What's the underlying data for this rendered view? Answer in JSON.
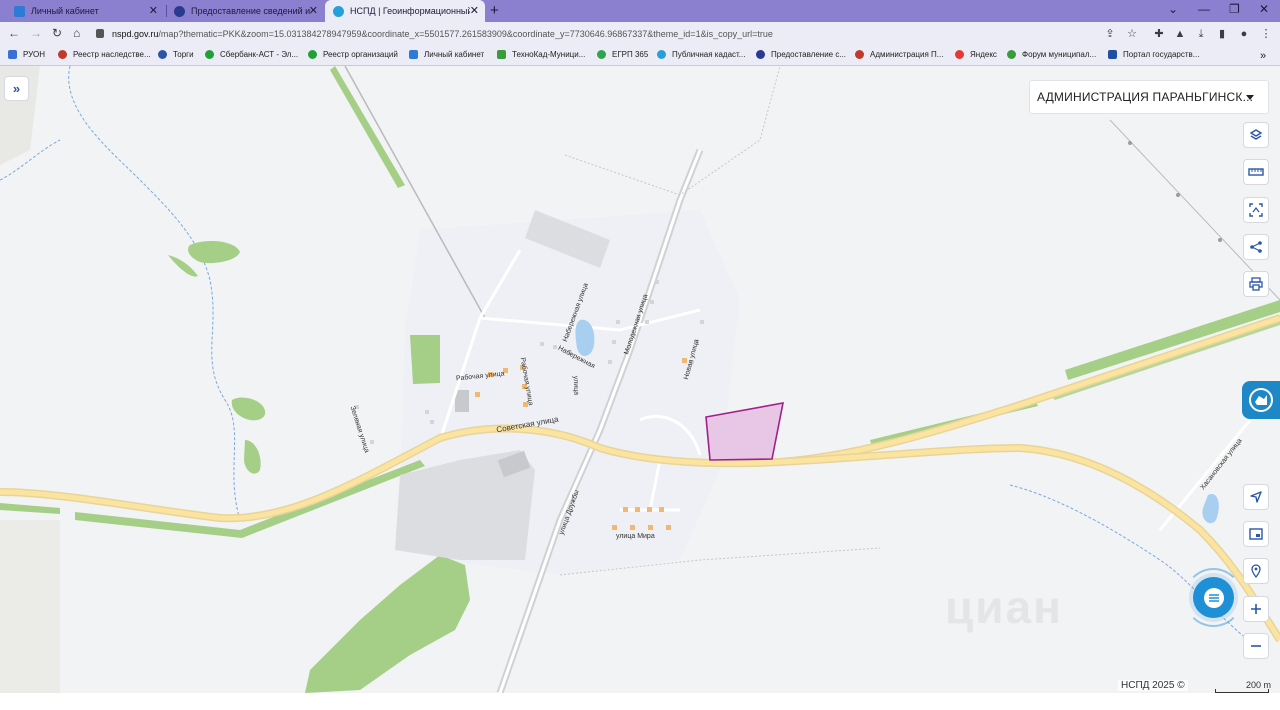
{
  "tabs": [
    {
      "title": "Личный кабинет",
      "favicon_color": "#2e7bd6"
    },
    {
      "title": "Предоставление сведений из Е",
      "favicon_color": "#2a3b8f"
    },
    {
      "title": "НСПД | Геоинформационный п",
      "favicon_color": "#26a0d8",
      "active": true
    }
  ],
  "address_bar": {
    "host": "nspd.gov.ru",
    "path": "/map?thematic=PKK&zoom=15.031384278947959&coordinate_x=5501577.261583909&coordinate_y=7730646.96867337&theme_id=1&is_copy_url=true"
  },
  "bookmarks": [
    {
      "label": "РУОН",
      "color": "#3b6fd8"
    },
    {
      "label": "Реестр наследстве...",
      "color": "#c0392b"
    },
    {
      "label": "Торги",
      "color": "#2a56a8"
    },
    {
      "label": "Сбербанк-АСТ - Эл...",
      "color": "#21a038"
    },
    {
      "label": "Реестр организаций",
      "color": "#21a038"
    },
    {
      "label": "Личный кабинет",
      "color": "#2e7bd6"
    },
    {
      "label": "ТехноКад-Муници...",
      "color": "#3a9b3a"
    },
    {
      "label": "ЕГРП 365",
      "color": "#2ea44f"
    },
    {
      "label": "Публичная кадаст...",
      "color": "#26a0d8"
    },
    {
      "label": "Предоставление с...",
      "color": "#2a3b8f"
    },
    {
      "label": "Администрация П...",
      "color": "#c0392b"
    },
    {
      "label": "Яндекс",
      "color": "#e53935"
    },
    {
      "label": "Форум муниципал...",
      "color": "#3a9b3a"
    },
    {
      "label": "Портал государств...",
      "color": "#1e4fa3"
    }
  ],
  "map": {
    "territory_select": "АДМИНИСТРАЦИЯ ПАРАНЬГИНСК...",
    "streets": {
      "sovetskaya": "Советская улица",
      "naberezhnaya1": "Набережная улица",
      "naberezhnaya2": "Набережная",
      "rabochaya": "Рабочая улица",
      "rabochaya2": "Рабочая улица",
      "molodezhnaya": "Молодежная улица",
      "novaya": "Новая улица",
      "zelenaya": "Зеленая улица",
      "druzhby": "улица Дружбы",
      "mira": "улица Мира",
      "khasanovskaya": "Хасановская улица",
      "ulitsa_short": "улица"
    },
    "watermark": "циан",
    "copyright": "НСПД 2025 ©",
    "scale_label": "200 m",
    "selected_parcel_color": "#a0208c"
  }
}
